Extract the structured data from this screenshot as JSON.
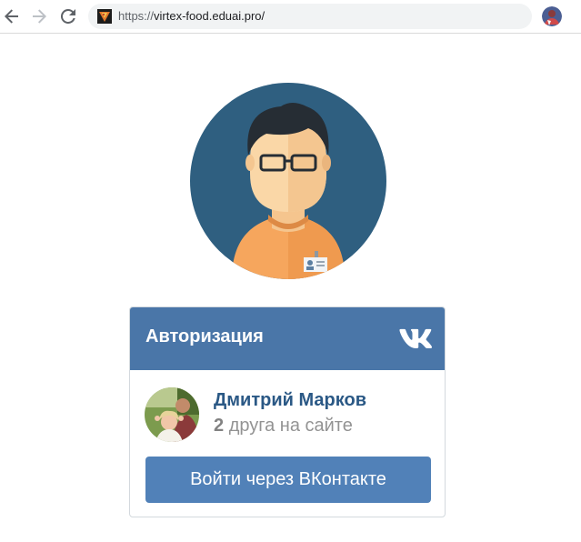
{
  "browser": {
    "url_scheme": "https://",
    "url_host": "virtex-food.eduai.pro/",
    "back_icon": "arrow-left-icon",
    "forward_icon": "arrow-right-icon",
    "reload_icon": "reload-icon"
  },
  "hero": {
    "icon": "user-avatar-illustration",
    "colors": {
      "circle": "#2f5f80",
      "hair": "#262d34",
      "skin": "#fad7a7",
      "shirt": "#f6a65d"
    }
  },
  "auth": {
    "title": "Авторизация",
    "vk_icon": "vk-logo-icon",
    "header_color": "#4a76a8",
    "user_name": "Дмитрий Марков",
    "friends_count": "2",
    "friends_text": "друга на сайте",
    "login_label": "Войти через ВКонтакте",
    "button_color": "#5181b8"
  }
}
